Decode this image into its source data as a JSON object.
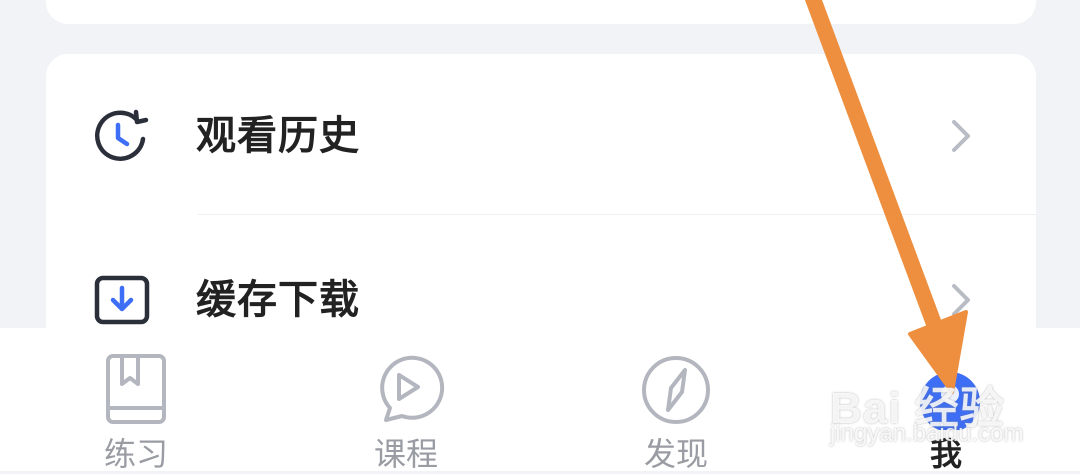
{
  "menu": {
    "items": [
      {
        "label": "观看历史",
        "icon": "history-clock-icon"
      },
      {
        "label": "缓存下载",
        "icon": "download-box-icon"
      }
    ]
  },
  "tabbar": {
    "tabs": [
      {
        "label": "练习",
        "icon": "practice-book-icon",
        "active": false
      },
      {
        "label": "课程",
        "icon": "course-play-icon",
        "active": false
      },
      {
        "label": "发现",
        "icon": "compass-icon",
        "active": false
      },
      {
        "label": "我",
        "icon": "profile-icon",
        "active": true
      }
    ]
  },
  "watermark": {
    "brand": "Bai 经验",
    "url": "jingyan.baidu.com"
  },
  "colors": {
    "background": "#f2f3f7",
    "card": "#ffffff",
    "text_primary": "#222222",
    "text_inactive": "#9a9ca4",
    "icon_dark": "#2b2f3a",
    "accent_blue": "#3d6ef5",
    "annotation_arrow": "#ee8f3f"
  }
}
